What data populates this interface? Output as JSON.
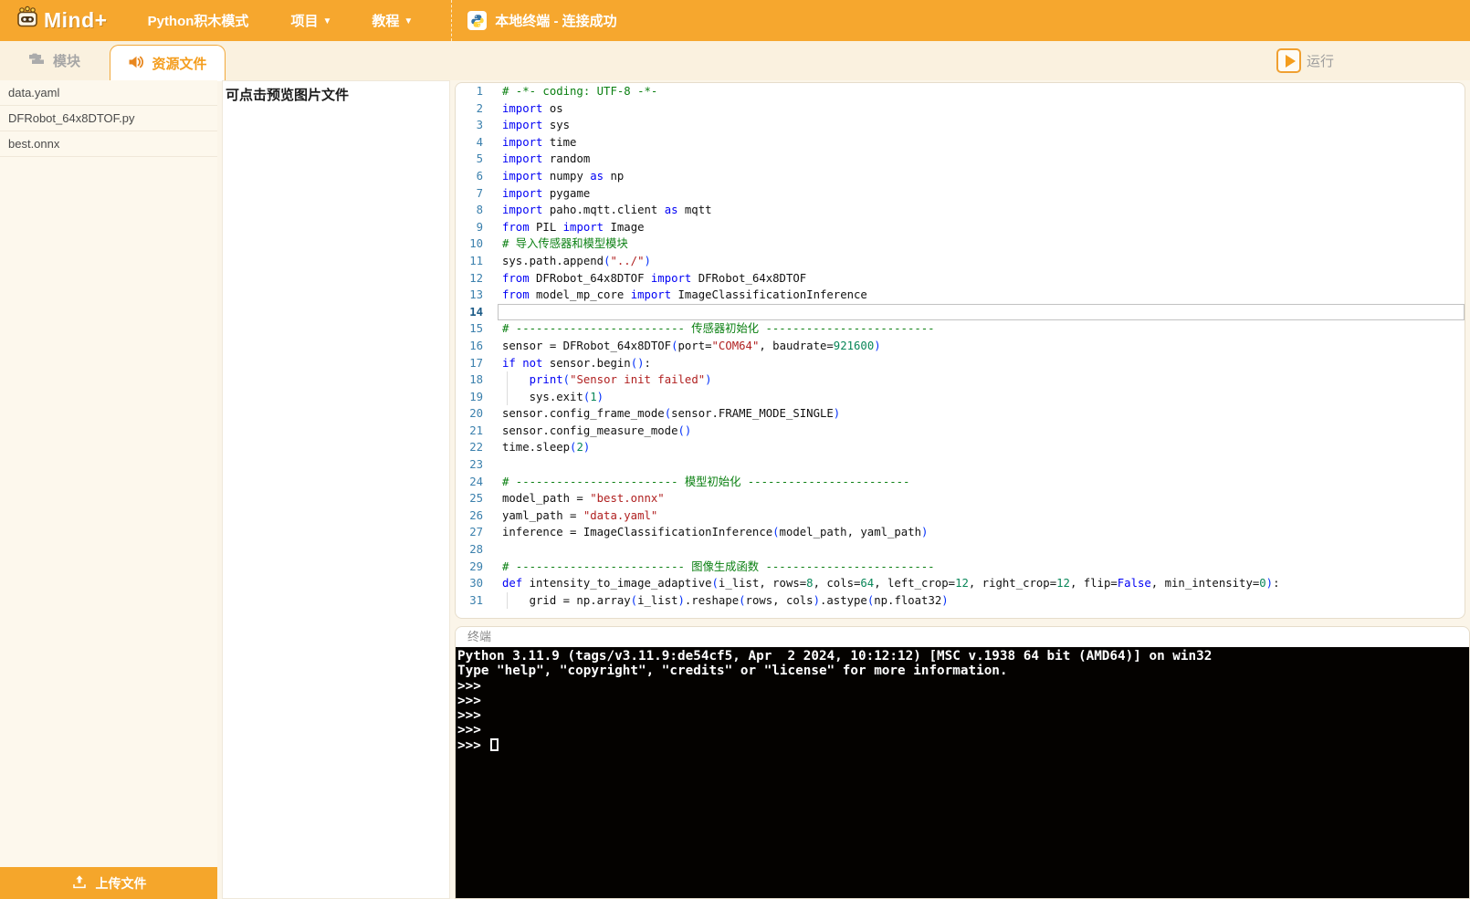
{
  "header": {
    "logo_text": "Mind+",
    "menu": [
      {
        "label": "Python积木模式",
        "caret": false
      },
      {
        "label": "项目",
        "caret": true
      },
      {
        "label": "教程",
        "caret": true
      }
    ],
    "terminal_status": "本地终端 - 连接成功"
  },
  "toolbar": {
    "tabs": [
      {
        "label": "模块",
        "icon": "blocks-icon",
        "active": false
      },
      {
        "label": "资源文件",
        "icon": "speaker-icon",
        "active": true
      }
    ],
    "run_label": "运行"
  },
  "sidebar": {
    "files": [
      "data.yaml",
      "DFRobot_64x8DTOF.py",
      "best.onnx"
    ],
    "upload_label": "上传文件"
  },
  "preview": {
    "hint": "可点击预览图片文件"
  },
  "editor": {
    "active_line": 14,
    "lines": [
      {
        "n": 1,
        "t": [
          [
            "com",
            "# -*- coding: UTF-8 -*-"
          ]
        ]
      },
      {
        "n": 2,
        "t": [
          [
            "kw",
            "import"
          ],
          [
            "pln",
            " os"
          ]
        ]
      },
      {
        "n": 3,
        "t": [
          [
            "kw",
            "import"
          ],
          [
            "pln",
            " sys"
          ]
        ]
      },
      {
        "n": 4,
        "t": [
          [
            "kw",
            "import"
          ],
          [
            "pln",
            " time"
          ]
        ]
      },
      {
        "n": 5,
        "t": [
          [
            "kw",
            "import"
          ],
          [
            "pln",
            " random"
          ]
        ]
      },
      {
        "n": 6,
        "t": [
          [
            "kw",
            "import"
          ],
          [
            "pln",
            " numpy "
          ],
          [
            "kw",
            "as"
          ],
          [
            "pln",
            " np"
          ]
        ]
      },
      {
        "n": 7,
        "t": [
          [
            "kw",
            "import"
          ],
          [
            "pln",
            " pygame"
          ]
        ]
      },
      {
        "n": 8,
        "t": [
          [
            "kw",
            "import"
          ],
          [
            "pln",
            " paho.mqtt.client "
          ],
          [
            "kw",
            "as"
          ],
          [
            "pln",
            " mqtt"
          ]
        ]
      },
      {
        "n": 9,
        "t": [
          [
            "kw",
            "from"
          ],
          [
            "pln",
            " PIL "
          ],
          [
            "kw",
            "import"
          ],
          [
            "pln",
            " Image"
          ]
        ]
      },
      {
        "n": 10,
        "t": [
          [
            "com",
            "# 导入传感器和模型模块"
          ]
        ]
      },
      {
        "n": 11,
        "t": [
          [
            "pln",
            "sys.path.append"
          ],
          [
            "p",
            "("
          ],
          [
            "str",
            "\"../\""
          ],
          [
            "p",
            ")"
          ]
        ]
      },
      {
        "n": 12,
        "t": [
          [
            "kw",
            "from"
          ],
          [
            "pln",
            " DFRobot_64x8DTOF "
          ],
          [
            "kw",
            "import"
          ],
          [
            "pln",
            " DFRobot_64x8DTOF"
          ]
        ]
      },
      {
        "n": 13,
        "t": [
          [
            "kw",
            "from"
          ],
          [
            "pln",
            " model_mp_core "
          ],
          [
            "kw",
            "import"
          ],
          [
            "pln",
            " ImageClassificationInference"
          ]
        ]
      },
      {
        "n": 14,
        "t": [],
        "active": true
      },
      {
        "n": 15,
        "t": [
          [
            "com",
            "# ------------------------- 传感器初始化 -------------------------"
          ]
        ]
      },
      {
        "n": 16,
        "t": [
          [
            "pln",
            "sensor = DFRobot_64x8DTOF"
          ],
          [
            "p",
            "("
          ],
          [
            "pln",
            "port="
          ],
          [
            "str",
            "\"COM64\""
          ],
          [
            "pln",
            ", baudrate="
          ],
          [
            "num",
            "921600"
          ],
          [
            "p",
            ")"
          ]
        ]
      },
      {
        "n": 17,
        "t": [
          [
            "kw",
            "if"
          ],
          [
            "pln",
            " "
          ],
          [
            "kw",
            "not"
          ],
          [
            "pln",
            " sensor.begin"
          ],
          [
            "p",
            "()"
          ],
          [
            "pln",
            ":"
          ]
        ]
      },
      {
        "n": 18,
        "t": [
          [
            "pln",
            "    "
          ],
          [
            "kw",
            "print"
          ],
          [
            "p",
            "("
          ],
          [
            "str",
            "\"Sensor init failed\""
          ],
          [
            "p",
            ")"
          ]
        ],
        "guide": true
      },
      {
        "n": 19,
        "t": [
          [
            "pln",
            "    sys.exit"
          ],
          [
            "p",
            "("
          ],
          [
            "num",
            "1"
          ],
          [
            "p",
            ")"
          ]
        ],
        "guide": true
      },
      {
        "n": 20,
        "t": [
          [
            "pln",
            "sensor.config_frame_mode"
          ],
          [
            "p",
            "("
          ],
          [
            "pln",
            "sensor.FRAME_MODE_SINGLE"
          ],
          [
            "p",
            ")"
          ]
        ]
      },
      {
        "n": 21,
        "t": [
          [
            "pln",
            "sensor.config_measure_mode"
          ],
          [
            "p",
            "()"
          ]
        ]
      },
      {
        "n": 22,
        "t": [
          [
            "pln",
            "time.sleep"
          ],
          [
            "p",
            "("
          ],
          [
            "num",
            "2"
          ],
          [
            "p",
            ")"
          ]
        ]
      },
      {
        "n": 23,
        "t": []
      },
      {
        "n": 24,
        "t": [
          [
            "com",
            "# ------------------------ 模型初始化 ------------------------"
          ]
        ]
      },
      {
        "n": 25,
        "t": [
          [
            "pln",
            "model_path = "
          ],
          [
            "str",
            "\"best.onnx\""
          ]
        ]
      },
      {
        "n": 26,
        "t": [
          [
            "pln",
            "yaml_path = "
          ],
          [
            "str",
            "\"data.yaml\""
          ]
        ]
      },
      {
        "n": 27,
        "t": [
          [
            "pln",
            "inference = ImageClassificationInference"
          ],
          [
            "p",
            "("
          ],
          [
            "pln",
            "model_path, yaml_path"
          ],
          [
            "p",
            ")"
          ]
        ]
      },
      {
        "n": 28,
        "t": []
      },
      {
        "n": 29,
        "t": [
          [
            "com",
            "# ------------------------- 图像生成函数 -------------------------"
          ]
        ]
      },
      {
        "n": 30,
        "t": [
          [
            "kw",
            "def"
          ],
          [
            "pln",
            " intensity_to_image_adaptive"
          ],
          [
            "p",
            "("
          ],
          [
            "pln",
            "i_list, rows="
          ],
          [
            "num",
            "8"
          ],
          [
            "pln",
            ", cols="
          ],
          [
            "num",
            "64"
          ],
          [
            "pln",
            ", left_crop="
          ],
          [
            "num",
            "12"
          ],
          [
            "pln",
            ", right_crop="
          ],
          [
            "num",
            "12"
          ],
          [
            "pln",
            ", flip="
          ],
          [
            "kw",
            "False"
          ],
          [
            "pln",
            ", min_intensity="
          ],
          [
            "num",
            "0"
          ],
          [
            "p",
            ")"
          ],
          [
            "pln",
            ":"
          ]
        ]
      },
      {
        "n": 31,
        "t": [
          [
            "pln",
            "    grid = np.array"
          ],
          [
            "p",
            "("
          ],
          [
            "pln",
            "i_list"
          ],
          [
            "p",
            ")"
          ],
          [
            "pln",
            ".reshape"
          ],
          [
            "p",
            "("
          ],
          [
            "pln",
            "rows, cols"
          ],
          [
            "p",
            ")"
          ],
          [
            "pln",
            ".astype"
          ],
          [
            "p",
            "("
          ],
          [
            "pln",
            "np.float32"
          ],
          [
            "p",
            ")"
          ]
        ],
        "guide": true
      }
    ]
  },
  "terminal": {
    "title": "终端",
    "lines": [
      "Python 3.11.9 (tags/v3.11.9:de54cf5, Apr  2 2024, 10:12:12) [MSC v.1938 64 bit (AMD64)] on win32",
      "Type \"help\", \"copyright\", \"credits\" or \"license\" for more information.",
      ">>>",
      ">>>",
      ">>>",
      ">>>",
      ">>> "
    ]
  },
  "colors": {
    "accent_orange": "#F6A72E",
    "tab_active_text": "#F49D1D",
    "cream_bg": "#FAF1DF",
    "terminal_bg": "#040200",
    "keyword": "#0000F5",
    "comment": "#0B8012",
    "string": "#B02020",
    "number": "#098658",
    "line_number": "#3B80AD"
  }
}
